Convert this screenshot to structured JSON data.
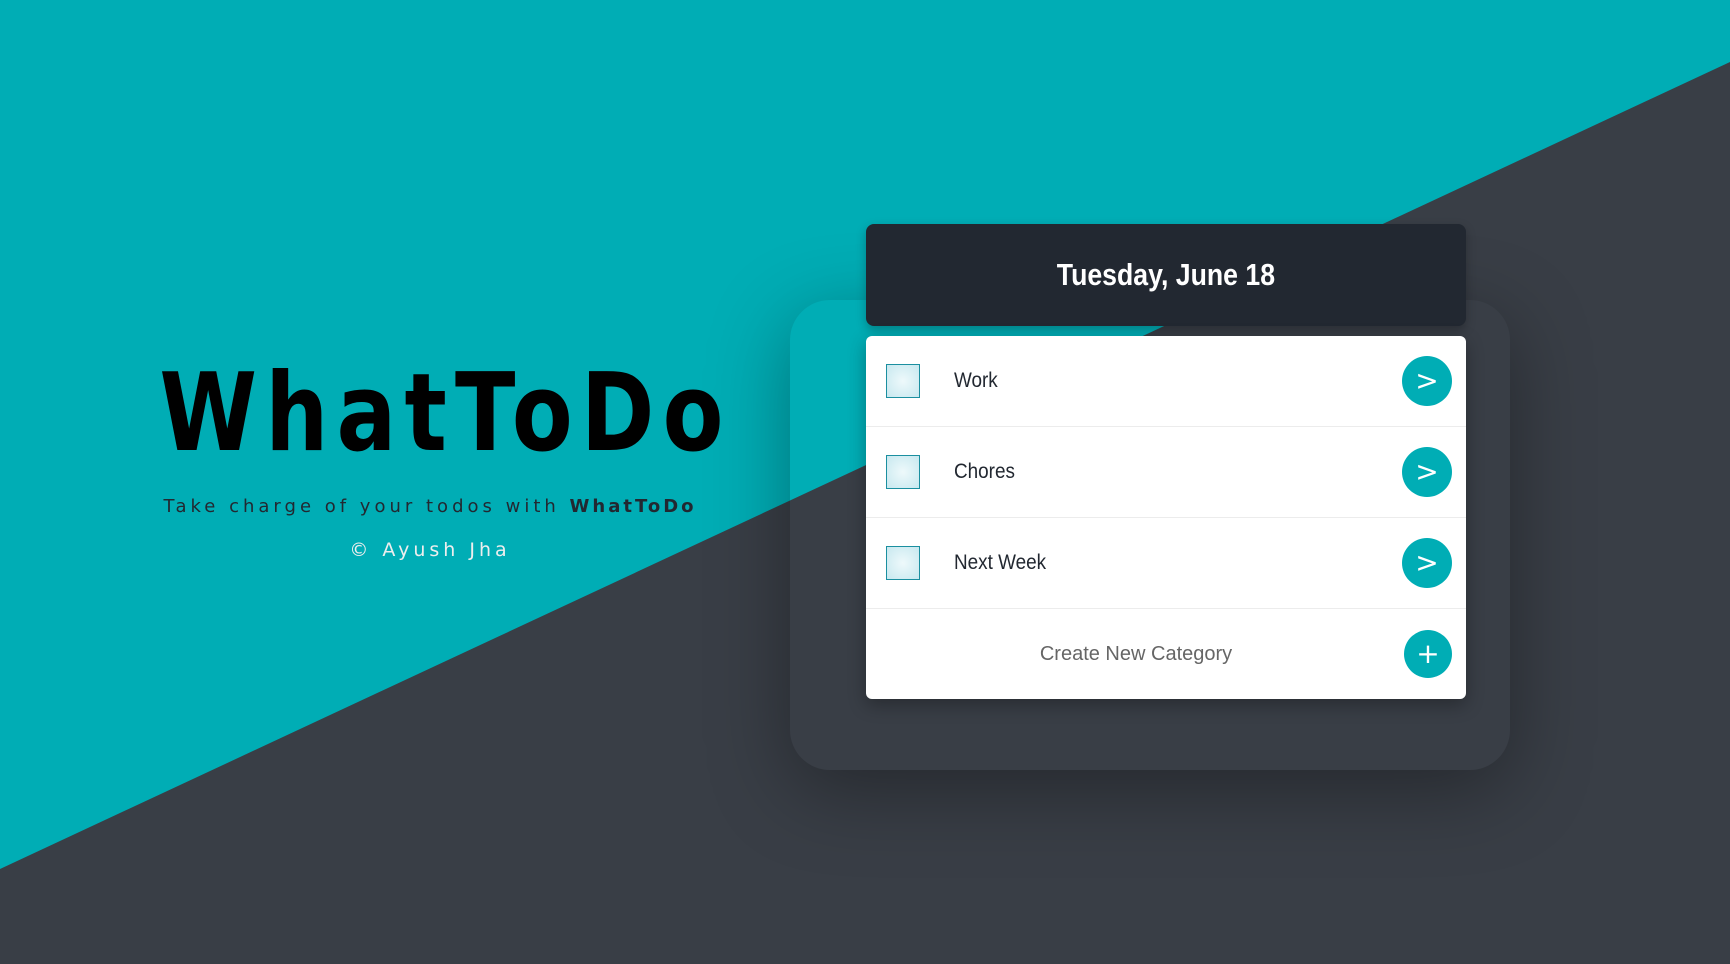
{
  "brand": {
    "title": "WhatToDo",
    "tagline_prefix": "Take charge of your todos with ",
    "tagline_strong": "WhatToDo",
    "copyright": "© Ayush Jha"
  },
  "header": {
    "date": "Tuesday, June 18"
  },
  "categories": [
    {
      "label": "Work",
      "button_label": ">",
      "checked": false
    },
    {
      "label": "Chores",
      "button_label": ">",
      "checked": false
    },
    {
      "label": "Next Week",
      "button_label": ">",
      "checked": false
    }
  ],
  "create": {
    "label": "Create New Category",
    "button_label": "+"
  },
  "colors": {
    "accent": "#00adb5",
    "dark": "#393e46",
    "header": "#222831",
    "card": "#ffffff"
  }
}
